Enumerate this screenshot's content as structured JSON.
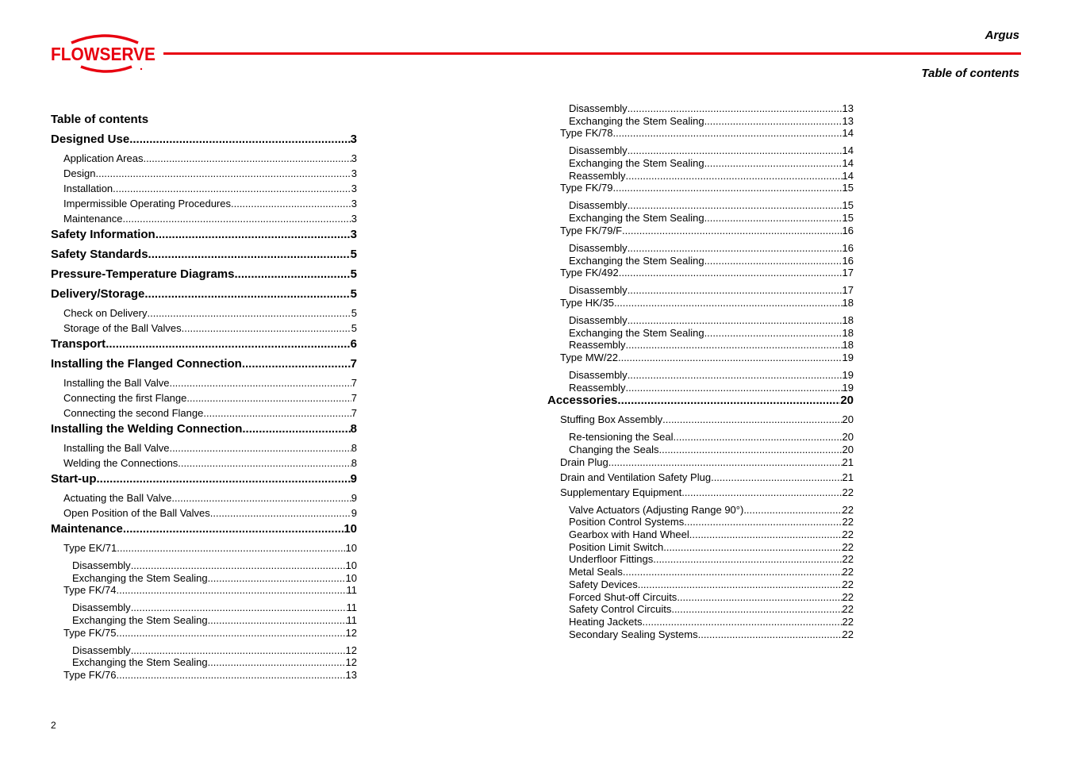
{
  "header": {
    "brand": "FLOWSERVE",
    "product": "Argus",
    "section": "Table of contents",
    "accent_color": "#e8000f"
  },
  "toc_title": "Table of contents",
  "left_column": [
    {
      "level": 1,
      "label": "Designed Use",
      "page": "3"
    },
    {
      "level": 2,
      "label": "Application Areas",
      "page": "3"
    },
    {
      "level": 2,
      "label": "Design",
      "page": "3"
    },
    {
      "level": 2,
      "label": "Installation",
      "page": "3"
    },
    {
      "level": 2,
      "label": "Impermissible Operating Procedures",
      "page": "3"
    },
    {
      "level": 2,
      "label": "Maintenance",
      "page": "3"
    },
    {
      "level": 1,
      "label": "Safety Information",
      "page": "3"
    },
    {
      "level": 1,
      "label": "Safety Standards",
      "page": "5"
    },
    {
      "level": 1,
      "label": "Pressure-Temperature Diagrams",
      "page": "5"
    },
    {
      "level": 1,
      "label": "Delivery/Storage",
      "page": "5"
    },
    {
      "level": 2,
      "label": "Check on Delivery",
      "page": "5"
    },
    {
      "level": 2,
      "label": "Storage of the Ball Valves",
      "page": "5"
    },
    {
      "level": 1,
      "label": "Transport",
      "page": "6"
    },
    {
      "level": 1,
      "label": "Installing the Flanged Connection",
      "page": "7"
    },
    {
      "level": 2,
      "label": "Installing the Ball Valve",
      "page": "7"
    },
    {
      "level": 2,
      "label": "Connecting the first Flange",
      "page": "7"
    },
    {
      "level": 2,
      "label": "Connecting the second Flange",
      "page": "7"
    },
    {
      "level": 1,
      "label": "Installing the Welding Connection",
      "page": "8"
    },
    {
      "level": 2,
      "label": "Installing the Ball Valve",
      "page": "8"
    },
    {
      "level": 2,
      "label": "Welding the Connections",
      "page": "8"
    },
    {
      "level": 1,
      "label": "Start-up",
      "page": "9"
    },
    {
      "level": 2,
      "label": "Actuating the Ball Valve",
      "page": "9"
    },
    {
      "level": 2,
      "label": "Open Position of the Ball Valves",
      "page": "9"
    },
    {
      "level": 1,
      "label": "Maintenance",
      "page": "10"
    },
    {
      "level": 2,
      "label": "Type EK/71",
      "page": "10"
    },
    {
      "level": 3,
      "label": "Disassembly",
      "page": "10"
    },
    {
      "level": 3,
      "label": "Exchanging the Stem Sealing",
      "page": "10"
    },
    {
      "level": 2,
      "label": "Type FK/74",
      "page": "11"
    },
    {
      "level": 3,
      "label": "Disassembly",
      "page": "11"
    },
    {
      "level": 3,
      "label": "Exchanging the Stem Sealing",
      "page": "11"
    },
    {
      "level": 2,
      "label": "Type FK/75",
      "page": "12"
    },
    {
      "level": 3,
      "label": "Disassembly",
      "page": "12"
    },
    {
      "level": 3,
      "label": "Exchanging the Stem Sealing",
      "page": "12"
    },
    {
      "level": 2,
      "label": "Type FK/76",
      "page": "13"
    }
  ],
  "right_column": [
    {
      "level": 3,
      "label": "Disassembly",
      "page": "13"
    },
    {
      "level": 3,
      "label": "Exchanging the Stem Sealing",
      "page": "13"
    },
    {
      "level": 2,
      "label": "Type FK/78",
      "page": "14"
    },
    {
      "level": 3,
      "label": "Disassembly",
      "page": "14"
    },
    {
      "level": 3,
      "label": "Exchanging the Stem Sealing",
      "page": "14"
    },
    {
      "level": 3,
      "label": "Reassembly",
      "page": "14"
    },
    {
      "level": 2,
      "label": "Type FK/79",
      "page": "15"
    },
    {
      "level": 3,
      "label": "Disassembly",
      "page": "15"
    },
    {
      "level": 3,
      "label": "Exchanging the Stem Sealing",
      "page": "15"
    },
    {
      "level": 2,
      "label": "Type FK/79/F",
      "page": "16"
    },
    {
      "level": 3,
      "label": "Disassembly",
      "page": "16"
    },
    {
      "level": 3,
      "label": "Exchanging the Stem Sealing",
      "page": "16"
    },
    {
      "level": 2,
      "label": "Type FK/492",
      "page": "17"
    },
    {
      "level": 3,
      "label": "Disassembly",
      "page": "17"
    },
    {
      "level": 2,
      "label": "Type HK/35",
      "page": "18"
    },
    {
      "level": 3,
      "label": "Disassembly",
      "page": "18"
    },
    {
      "level": 3,
      "label": "Exchanging the Stem Sealing",
      "page": "18"
    },
    {
      "level": 3,
      "label": "Reassembly",
      "page": "18"
    },
    {
      "level": 2,
      "label": "Type MW/22",
      "page": "19"
    },
    {
      "level": 3,
      "label": "Disassembly",
      "page": "19"
    },
    {
      "level": 3,
      "label": "Reassembly",
      "page": "19"
    },
    {
      "level": 1,
      "label": "Accessories",
      "page": "20"
    },
    {
      "level": 2,
      "label": "Stuffing Box Assembly",
      "page": "20"
    },
    {
      "level": 3,
      "label": "Re-tensioning the Seal",
      "page": "20"
    },
    {
      "level": 3,
      "label": "Changing the Seals",
      "page": "20"
    },
    {
      "level": 2,
      "label": "Drain Plug",
      "page": "21"
    },
    {
      "level": 2,
      "label": "Drain and Ventilation Safety Plug",
      "page": "21"
    },
    {
      "level": 2,
      "label": "Supplementary Equipment",
      "page": "22"
    },
    {
      "level": 3,
      "label": "Valve Actuators (Adjusting Range 90°)",
      "page": "22"
    },
    {
      "level": 3,
      "label": "Position Control Systems",
      "page": "22"
    },
    {
      "level": 3,
      "label": "Gearbox with Hand Wheel",
      "page": "22"
    },
    {
      "level": 3,
      "label": "Position Limit Switch",
      "page": "22"
    },
    {
      "level": 3,
      "label": "Underfloor Fittings",
      "page": "22"
    },
    {
      "level": 3,
      "label": "Metal Seals",
      "page": "22"
    },
    {
      "level": 3,
      "label": "Safety Devices",
      "page": "22"
    },
    {
      "level": 3,
      "label": "Forced Shut-off Circuits",
      "page": "22"
    },
    {
      "level": 3,
      "label": "Safety Control Circuits",
      "page": "22"
    },
    {
      "level": 3,
      "label": "Heating Jackets",
      "page": "22"
    },
    {
      "level": 3,
      "label": "Secondary Sealing Systems",
      "page": "22"
    }
  ],
  "footer": {
    "page_number": "2"
  }
}
